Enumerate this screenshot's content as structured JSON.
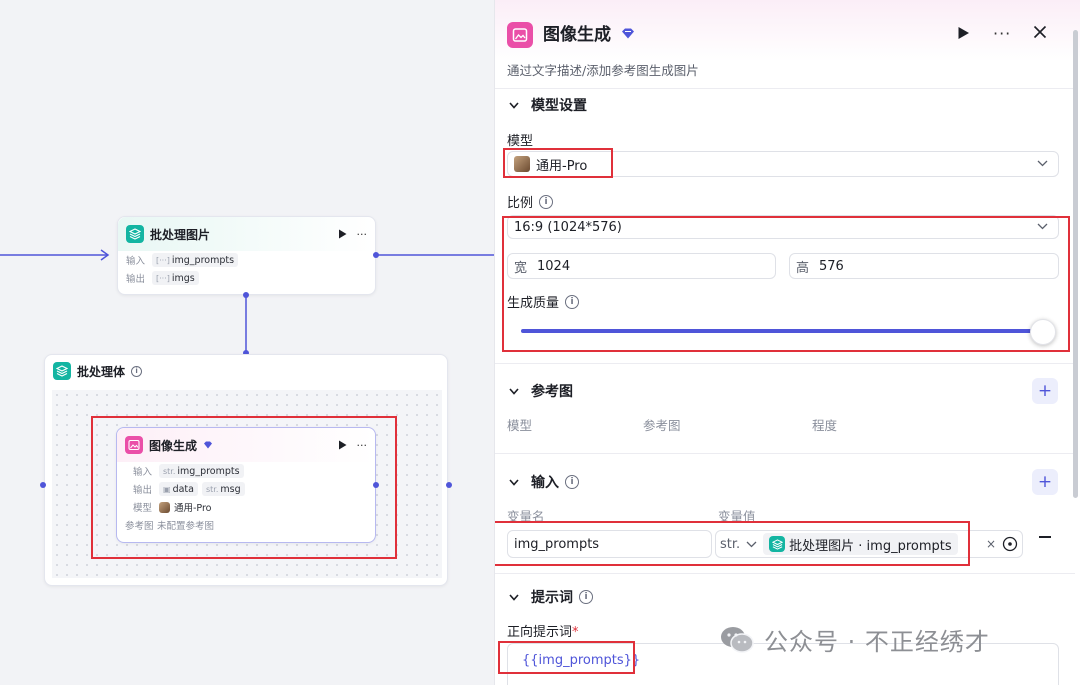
{
  "canvas": {
    "batch_images_node": {
      "title": "批处理图片",
      "input_label": "输入",
      "input_value": "img_prompts",
      "output_label": "输出",
      "output_value": "imgs"
    },
    "batch_body_node": {
      "title": "批处理体"
    },
    "image_gen_node": {
      "title": "图像生成",
      "input_label": "输入",
      "input_type": "str.",
      "input_value": "img_prompts",
      "output_label": "输出",
      "output_value_1": "data",
      "output_type_2": "str.",
      "output_value_2": "msg",
      "model_label": "模型",
      "model_value": "通用-Pro",
      "ref_label": "参考图",
      "ref_value": "未配置参考图"
    }
  },
  "panel": {
    "title": "图像生成",
    "description": "通过文字描述/添加参考图生成图片",
    "model_settings": {
      "section_title": "模型设置",
      "model_label": "模型",
      "model_value": "通用-Pro",
      "ratio_label": "比例",
      "ratio_value": "16:9 (1024*576)",
      "width_label": "宽",
      "width_value": "1024",
      "height_label": "高",
      "height_value": "576",
      "quality_label": "生成质量",
      "quality_level": 1.0
    },
    "reference": {
      "section_title": "参考图",
      "col_model": "模型",
      "col_ref": "参考图",
      "col_degree": "程度"
    },
    "input": {
      "section_title": "输入",
      "col_name": "变量名",
      "col_value": "变量值",
      "var_name": "img_prompts",
      "var_type": "str.",
      "var_source": "批处理图片 · img_prompts"
    },
    "prompt": {
      "section_title": "提示词",
      "positive_label": "正向提示词",
      "required_mark": "*",
      "positive_value": "{{img_prompts}}"
    }
  },
  "watermark": "公众号 · 不正经绣才",
  "colors": {
    "accent": "#4f55d9",
    "pink": "#ea4fa8",
    "teal": "#13b5a2",
    "highlight_red": "#e0303a"
  }
}
